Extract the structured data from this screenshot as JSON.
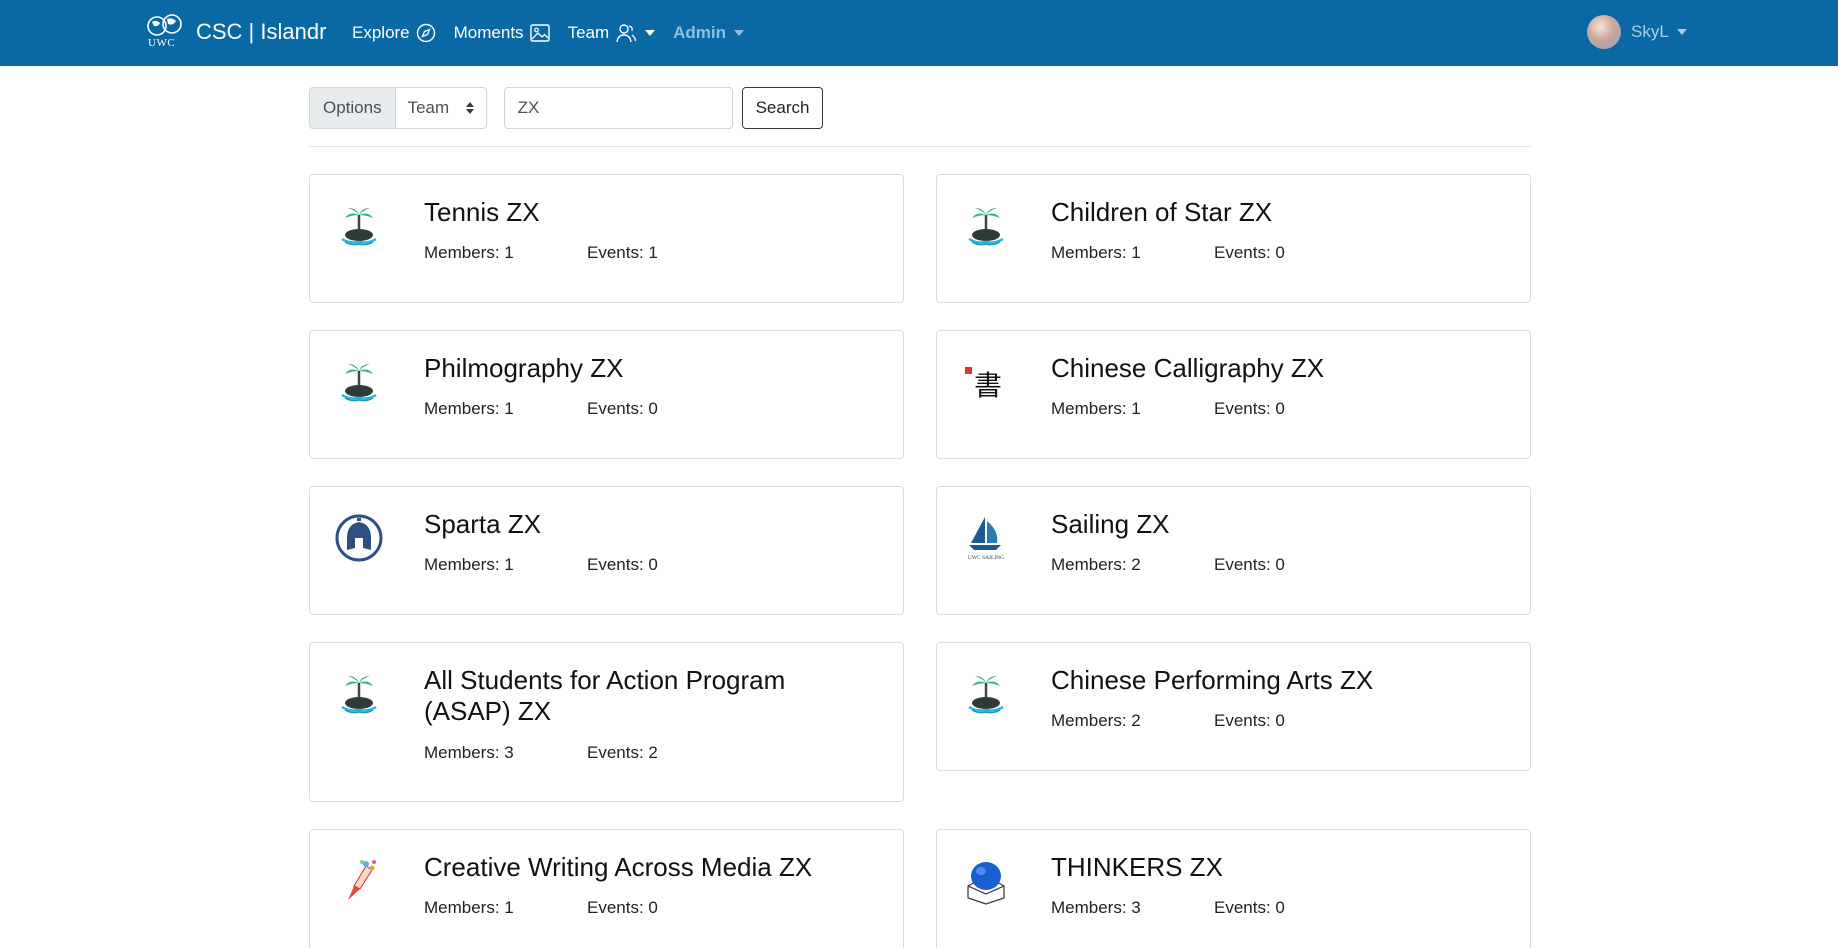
{
  "nav": {
    "brand": "CSC | Islandr",
    "brand_logo_text": "UWC",
    "explore": "Explore",
    "moments": "Moments",
    "team": "Team",
    "admin": "Admin",
    "user": "SkyL"
  },
  "search": {
    "options_label": "Options",
    "select_value": "Team",
    "query": "ZX",
    "button": "Search"
  },
  "cards": [
    {
      "title": "Tennis ZX",
      "members": "Members: 1",
      "events": "Events: 1",
      "icon": "island-icon"
    },
    {
      "title": "Children of Star ZX",
      "members": "Members: 1",
      "events": "Events: 0",
      "icon": "island-icon"
    },
    {
      "title": "Philmography ZX",
      "members": "Members: 1",
      "events": "Events: 0",
      "icon": "island-icon"
    },
    {
      "title": "Chinese Calligraphy ZX",
      "members": "Members: 1",
      "events": "Events: 0",
      "icon": "calligraphy-icon"
    },
    {
      "title": "Sparta ZX",
      "members": "Members: 1",
      "events": "Events: 0",
      "icon": "spartan-helmet-icon"
    },
    {
      "title": "Sailing ZX",
      "members": "Members: 2",
      "events": "Events: 0",
      "icon": "sailboat-icon"
    },
    {
      "title": "All Students for Action Program (ASAP) ZX",
      "members": "Members: 3",
      "events": "Events: 2",
      "icon": "island-icon"
    },
    {
      "title": "Chinese Performing Arts ZX",
      "members": "Members: 2",
      "events": "Events: 0",
      "icon": "island-icon"
    },
    {
      "title": "Creative Writing Across Media ZX",
      "members": "Members: 1",
      "events": "Events: 0",
      "icon": "pen-icon"
    },
    {
      "title": "THINKERS ZX",
      "members": "Members: 3",
      "events": "Events: 0",
      "icon": "thinkers-icon"
    }
  ],
  "logo_texts": {
    "calligraphy": "書",
    "sailing": "UWC SAILING"
  }
}
